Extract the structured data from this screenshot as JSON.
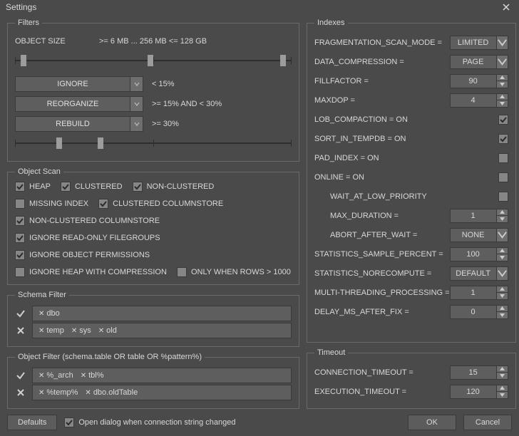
{
  "window": {
    "title": "Settings"
  },
  "filters": {
    "legend": "Filters",
    "size_label": "OBJECT SIZE",
    "size_text": ">= 6 MB ... 256 MB <= 128 GB",
    "thresholds": [
      {
        "action": "IGNORE",
        "text": "< 15%"
      },
      {
        "action": "REORGANIZE",
        "text": ">= 15% AND < 30%"
      },
      {
        "action": "REBUILD",
        "text": ">= 30%"
      }
    ]
  },
  "object_scan": {
    "legend": "Object Scan",
    "items": [
      {
        "label": "HEAP",
        "checked": true
      },
      {
        "label": "CLUSTERED",
        "checked": true
      },
      {
        "label": "NON-CLUSTERED",
        "checked": true
      },
      {
        "label": "MISSING INDEX",
        "checked": false
      },
      {
        "label": "CLUSTERED COLUMNSTORE",
        "checked": true
      },
      {
        "label": "NON-CLUSTERED COLUMNSTORE",
        "checked": true
      },
      {
        "label": "IGNORE READ-ONLY FILEGROUPS",
        "checked": true
      },
      {
        "label": "IGNORE OBJECT PERMISSIONS",
        "checked": true
      },
      {
        "label": "IGNORE HEAP WITH COMPRESSION",
        "checked": false
      },
      {
        "label": "ONLY WHEN ROWS > 1000",
        "checked": false
      }
    ]
  },
  "schema_filter": {
    "legend": "Schema Filter",
    "include": [
      "dbo"
    ],
    "exclude": [
      "temp",
      "sys",
      "old"
    ]
  },
  "object_filter": {
    "legend": "Object Filter (schema.table OR table OR %pattern%)",
    "include": [
      "%_arch",
      "tbl%"
    ],
    "exclude": [
      "%temp%",
      "dbo.oldTable"
    ]
  },
  "indexes": {
    "legend": "Indexes",
    "frag_mode": {
      "label": "FRAGMENTATION_SCAN_MODE =",
      "value": "LIMITED"
    },
    "data_compression": {
      "label": "DATA_COMPRESSION =",
      "value": "PAGE"
    },
    "fillfactor": {
      "label": "FILLFACTOR =",
      "value": "90"
    },
    "maxdop": {
      "label": "MAXDOP =",
      "value": "4"
    },
    "lob_compaction": {
      "label": "LOB_COMPACTION = ON",
      "checked": true
    },
    "sort_in_tempdb": {
      "label": "SORT_IN_TEMPDB = ON",
      "checked": true
    },
    "pad_index": {
      "label": "PAD_INDEX = ON",
      "checked": false
    },
    "online": {
      "label": "ONLINE = ON",
      "checked": false
    },
    "wait_low": {
      "label": "WAIT_AT_LOW_PRIORITY",
      "checked": false
    },
    "max_duration": {
      "label": "MAX_DURATION =",
      "value": "1"
    },
    "abort_after_wait": {
      "label": "ABORT_AFTER_WAIT =",
      "value": "NONE"
    },
    "stats_sample": {
      "label": "STATISTICS_SAMPLE_PERCENT =",
      "value": "100"
    },
    "stats_norecompute": {
      "label": "STATISTICS_NORECOMPUTE =",
      "value": "DEFAULT"
    },
    "multithread": {
      "label": "MULTI-THREADING_PROCESSING =",
      "value": "1"
    },
    "delay_ms": {
      "label": "DELAY_MS_AFTER_FIX =",
      "value": "0"
    }
  },
  "timeout": {
    "legend": "Timeout",
    "connection": {
      "label": "CONNECTION_TIMEOUT =",
      "value": "15"
    },
    "execution": {
      "label": "EXECUTION_TIMEOUT =",
      "value": "120"
    }
  },
  "bottom": {
    "defaults": "Defaults",
    "open_dialog": {
      "label": "Open dialog when connection string changed",
      "checked": true
    },
    "ok": "OK",
    "cancel": "Cancel"
  }
}
